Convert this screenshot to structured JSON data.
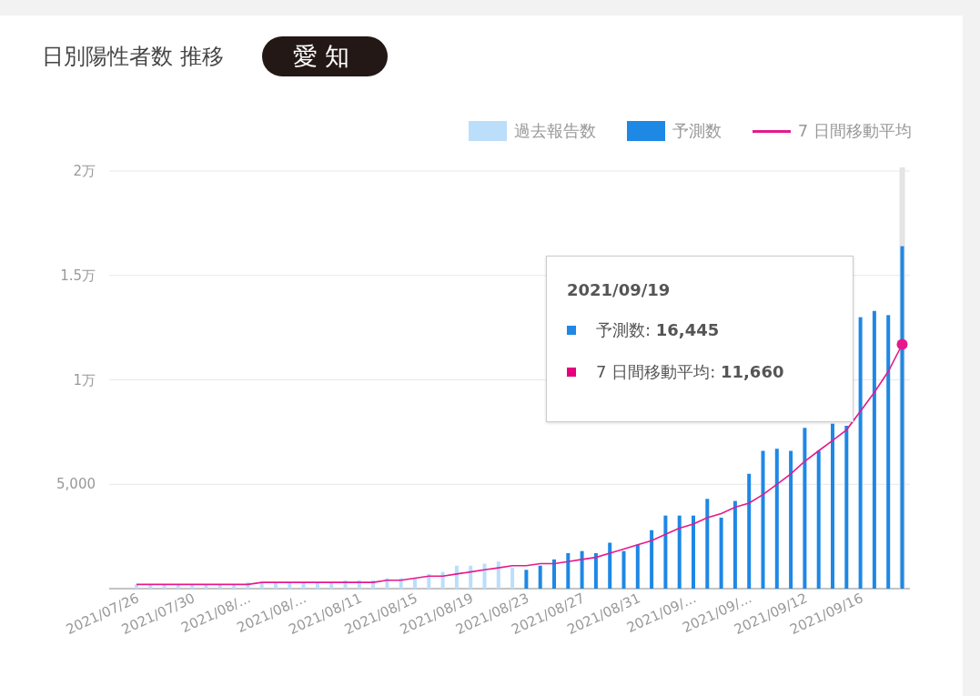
{
  "title": "日別陽性者数 推移",
  "region_badge": "愛知",
  "chart_data": {
    "type": "bar",
    "categories": [
      "2021/07/26",
      null,
      null,
      null,
      "2021/07/30",
      null,
      null,
      null,
      "2021/08/...",
      null,
      null,
      null,
      "2021/08/...",
      null,
      null,
      null,
      "2021/08/11",
      null,
      null,
      null,
      "2021/08/15",
      null,
      null,
      null,
      "2021/08/19",
      null,
      null,
      null,
      "2021/08/23",
      null,
      null,
      null,
      "2021/08/27",
      null,
      null,
      null,
      "2021/08/31",
      null,
      null,
      null,
      "2021/09/...",
      null,
      null,
      null,
      "2021/09/...",
      null,
      null,
      null,
      "2021/09/12",
      null,
      null,
      null,
      "2021/09/16",
      null,
      null,
      null
    ],
    "ylim": [
      0,
      2
    ],
    "grid": true,
    "yticks": [
      {
        "label": "5,000"
      },
      {
        "value": 1,
        "label": "1万"
      },
      {
        "value": 1.5,
        "label": "1.5万"
      },
      {
        "value": 2,
        "label": "2万"
      }
    ],
    "series": [
      {
        "name": "過去報告数",
        "color": "#bbdefb",
        "values": [
          0.02,
          0.02,
          0.02,
          0.02,
          0.02,
          0.02,
          0.02,
          0.02,
          0.03,
          0.03,
          0.03,
          0.03,
          0.03,
          0.03,
          0.03,
          0.04,
          0.04,
          0.04,
          0.05,
          0.05,
          0.05,
          0.07,
          0.08,
          0.11,
          0.11,
          0.12,
          0.13,
          0.1,
          null,
          null,
          null,
          null,
          null,
          null,
          null,
          null,
          null,
          null,
          null,
          null,
          null,
          null,
          null,
          null,
          null,
          null,
          null,
          null,
          null,
          null,
          null,
          null,
          null,
          null,
          null,
          null
        ]
      },
      {
        "name": "予測数",
        "color": "#1e88e5",
        "values": [
          null,
          null,
          null,
          null,
          null,
          null,
          null,
          null,
          null,
          null,
          null,
          null,
          null,
          null,
          null,
          null,
          null,
          null,
          null,
          null,
          null,
          null,
          null,
          null,
          null,
          null,
          null,
          null,
          0.09,
          0.11,
          0.14,
          0.17,
          0.18,
          0.17,
          0.22,
          0.18,
          0.21,
          0.28,
          0.35,
          0.35,
          0.35,
          0.43,
          0.34,
          0.42,
          0.55,
          0.66,
          0.67,
          0.66,
          0.77,
          0.66,
          0.79,
          0.78,
          1.3,
          1.33,
          1.31,
          1.64
        ]
      },
      {
        "name": "7 日間移動平均",
        "type": "line",
        "color": "#e6198c",
        "values": [
          0.02,
          0.02,
          0.02,
          0.02,
          0.02,
          0.02,
          0.02,
          0.02,
          0.02,
          0.03,
          0.03,
          0.03,
          0.03,
          0.03,
          0.03,
          0.03,
          0.03,
          0.03,
          0.04,
          0.04,
          0.05,
          0.06,
          0.06,
          0.07,
          0.08,
          0.09,
          0.1,
          0.11,
          0.11,
          0.12,
          0.12,
          0.13,
          0.14,
          0.15,
          0.17,
          0.19,
          0.21,
          0.23,
          0.26,
          0.29,
          0.31,
          0.34,
          0.36,
          0.39,
          0.41,
          0.45,
          0.5,
          0.55,
          0.61,
          0.66,
          0.71,
          0.76,
          0.85,
          0.94,
          1.04,
          1.17
        ]
      }
    ]
  },
  "tooltip": {
    "date": "2021/09/19",
    "rows": [
      {
        "text": "予測数: **16,445**",
        "color": "#1e88e5"
      },
      {
        "text": "7 日間移動平均: **11,660**",
        "color": "#e6007e"
      }
    ]
  }
}
